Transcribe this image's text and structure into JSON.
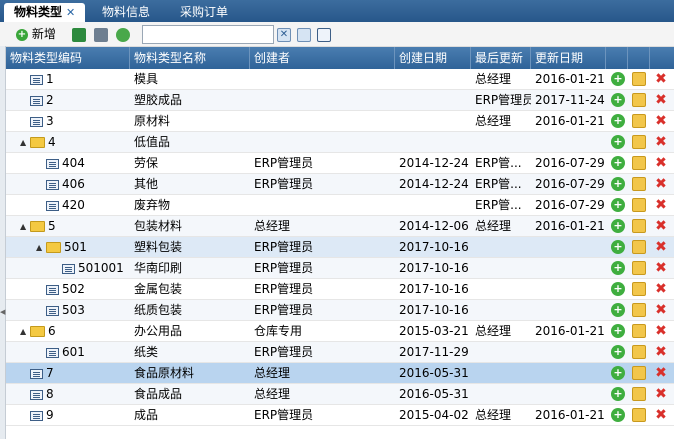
{
  "tabs": [
    {
      "label": "物料类型",
      "active": true
    },
    {
      "label": "物料信息",
      "active": false
    },
    {
      "label": "采购订单",
      "active": false
    }
  ],
  "toolbar": {
    "add_label": "新增",
    "search_value": ""
  },
  "columns": [
    "物料类型编码",
    "物料类型名称",
    "创建者",
    "创建日期",
    "最后更新",
    "更新日期"
  ],
  "rows": [
    {
      "code": "1",
      "name": "模具",
      "creator": "",
      "created": "",
      "updater": "总经理",
      "updated": "2016-01-21",
      "type": "leaf",
      "depth": 0,
      "expand": ""
    },
    {
      "code": "2",
      "name": "塑胶成品",
      "creator": "",
      "created": "",
      "updater": "ERP管理员",
      "updated": "2017-11-24",
      "type": "leaf",
      "depth": 0,
      "expand": ""
    },
    {
      "code": "3",
      "name": "原材料",
      "creator": "",
      "created": "",
      "updater": "总经理",
      "updated": "2016-01-21",
      "type": "leaf",
      "depth": 0,
      "expand": ""
    },
    {
      "code": "4",
      "name": "低值品",
      "creator": "",
      "created": "",
      "updater": "",
      "updated": "",
      "type": "folder",
      "depth": 0,
      "expand": "▲"
    },
    {
      "code": "404",
      "name": "劳保",
      "creator": "ERP管理员",
      "created": "2014-12-24",
      "updater": "ERP管...",
      "updated": "2016-07-29",
      "type": "leaf",
      "depth": 1,
      "expand": ""
    },
    {
      "code": "406",
      "name": "其他",
      "creator": "ERP管理员",
      "created": "2014-12-24",
      "updater": "ERP管...",
      "updated": "2016-07-29",
      "type": "leaf",
      "depth": 1,
      "expand": ""
    },
    {
      "code": "420",
      "name": "废弃物",
      "creator": "",
      "created": "",
      "updater": "ERP管...",
      "updated": "2016-07-29",
      "type": "leaf",
      "depth": 1,
      "expand": ""
    },
    {
      "code": "5",
      "name": "包装材料",
      "creator": "总经理",
      "created": "2014-12-06",
      "updater": "总经理",
      "updated": "2016-01-21",
      "type": "folder",
      "depth": 0,
      "expand": "▲"
    },
    {
      "code": "501",
      "name": "塑料包装",
      "creator": "ERP管理员",
      "created": "2017-10-16",
      "updater": "",
      "updated": "",
      "type": "folder",
      "depth": 1,
      "expand": "▲"
    },
    {
      "code": "501001",
      "name": "华南印刷",
      "creator": "ERP管理员",
      "created": "2017-10-16",
      "updater": "",
      "updated": "",
      "type": "leaf",
      "depth": 2,
      "expand": ""
    },
    {
      "code": "502",
      "name": "金属包装",
      "creator": "ERP管理员",
      "created": "2017-10-16",
      "updater": "",
      "updated": "",
      "type": "leaf",
      "depth": 1,
      "expand": ""
    },
    {
      "code": "503",
      "name": "纸质包装",
      "creator": "ERP管理员",
      "created": "2017-10-16",
      "updater": "",
      "updated": "",
      "type": "leaf",
      "depth": 1,
      "expand": ""
    },
    {
      "code": "6",
      "name": "办公用品",
      "creator": "仓库专用",
      "created": "2015-03-21",
      "updater": "总经理",
      "updated": "2016-01-21",
      "type": "folder",
      "depth": 0,
      "expand": "▲"
    },
    {
      "code": "601",
      "name": "纸类",
      "creator": "ERP管理员",
      "created": "2017-11-29",
      "updater": "",
      "updated": "",
      "type": "leaf",
      "depth": 1,
      "expand": ""
    },
    {
      "code": "7",
      "name": "食品原材料",
      "creator": "总经理",
      "created": "2016-05-31",
      "updater": "",
      "updated": "",
      "type": "leaf",
      "depth": 0,
      "expand": ""
    },
    {
      "code": "8",
      "name": "食品成品",
      "creator": "总经理",
      "created": "2016-05-31",
      "updater": "",
      "updated": "",
      "type": "leaf",
      "depth": 0,
      "expand": ""
    },
    {
      "code": "9",
      "name": "成品",
      "creator": "ERP管理员",
      "created": "2015-04-02",
      "updater": "总经理",
      "updated": "2016-01-21",
      "type": "leaf",
      "depth": 0,
      "expand": ""
    }
  ]
}
